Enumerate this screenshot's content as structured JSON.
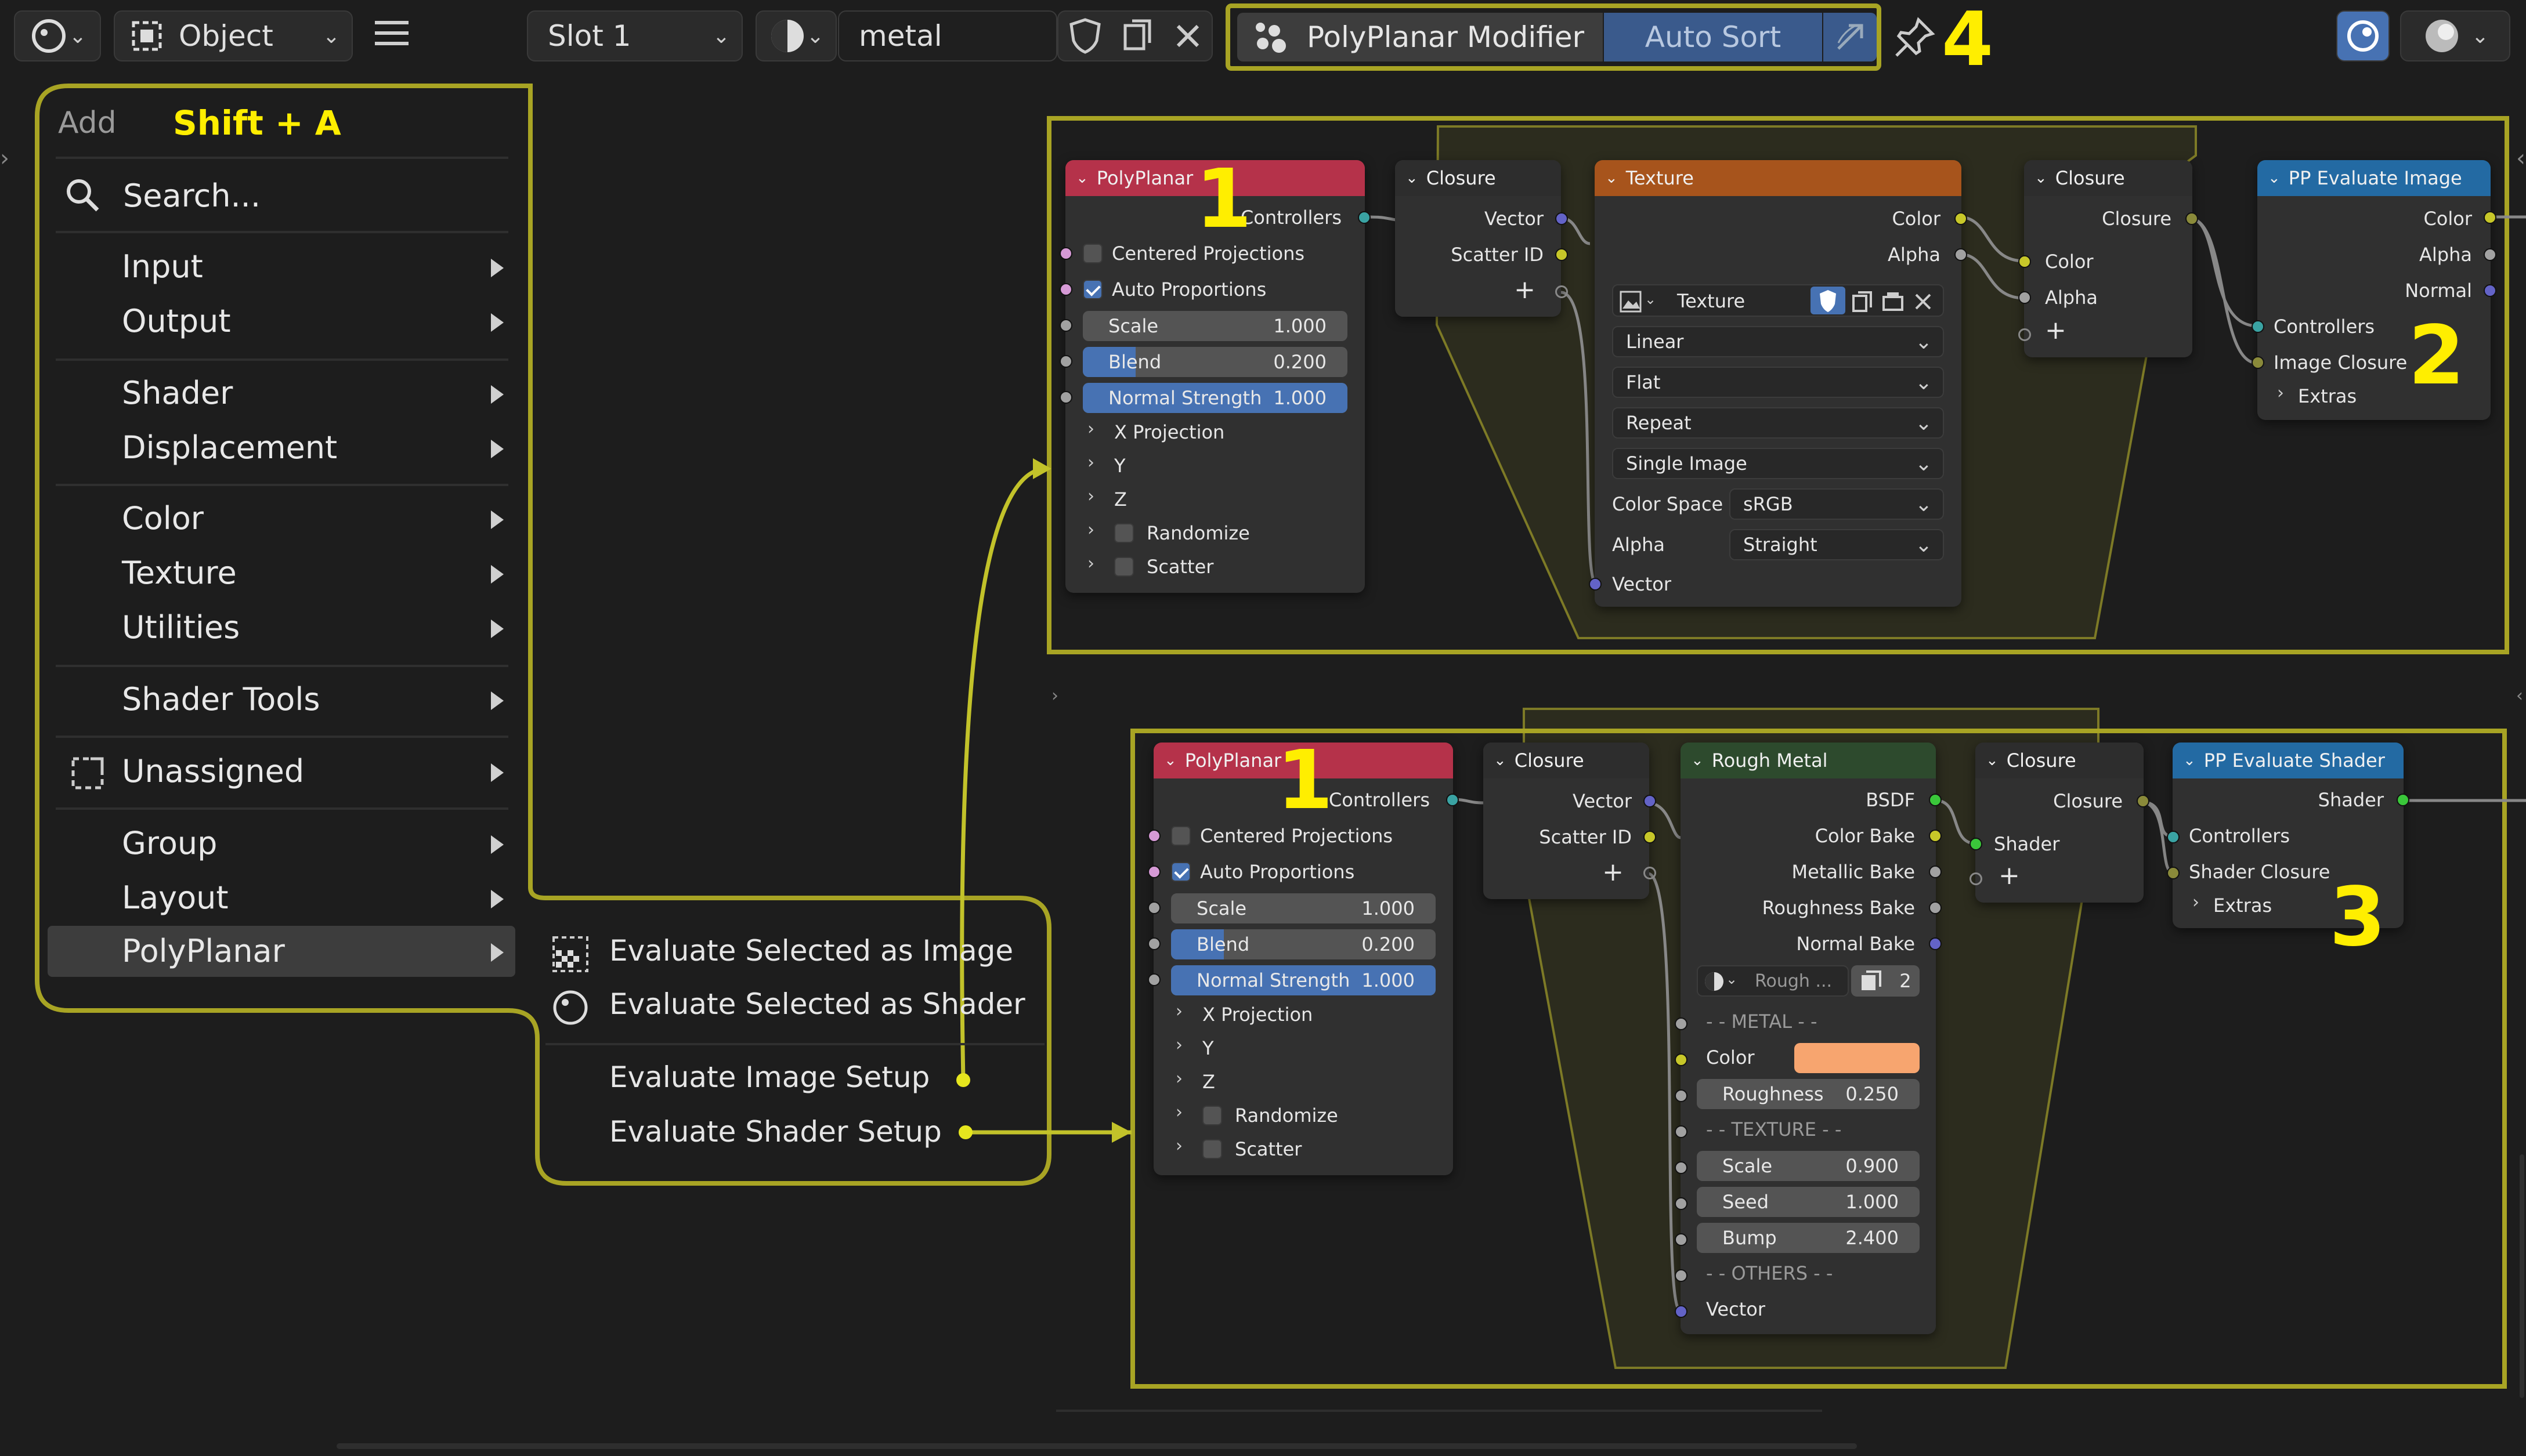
{
  "header": {
    "mode": "Object",
    "slot": "Slot 1",
    "material": "metal",
    "panel_title": "PolyPlanar Modifier",
    "auto_sort": "Auto Sort",
    "annotation": "4"
  },
  "add_menu": {
    "title": "Add",
    "shortcut": "Shift + A",
    "search_placeholder": "Search...",
    "items": [
      "Input",
      "Output",
      "Shader",
      "Displacement",
      "Color",
      "Texture",
      "Utilities",
      "Shader Tools",
      "Unassigned",
      "Group",
      "Layout",
      "PolyPlanar"
    ]
  },
  "submenu": {
    "items": [
      "Evaluate Selected as Image",
      "Evaluate Selected as Shader",
      "Evaluate Image Setup",
      "Evaluate Shader Setup"
    ]
  },
  "annotations": {
    "n1a": "1",
    "n1b": "1",
    "n2": "2",
    "n3": "3"
  },
  "top": {
    "polyplanar": {
      "title": "PolyPlanar",
      "controllers": "Controllers",
      "centered": "Centered Projections",
      "auto_prop": "Auto Proportions",
      "scale_label": "Scale",
      "scale": "1.000",
      "blend_label": "Blend",
      "blend": "0.200",
      "normal_label": "Normal Strength",
      "normal": "1.000",
      "xproj": "X Projection",
      "y": "Y",
      "z": "Z",
      "randomize": "Randomize",
      "scatter": "Scatter"
    },
    "closure1": {
      "title": "Closure",
      "vector": "Vector",
      "scatter_id": "Scatter ID"
    },
    "texture": {
      "title": "Texture",
      "color": "Color",
      "alpha": "Alpha",
      "tex_name": "Texture",
      "interp": "Linear",
      "proj": "Flat",
      "ext": "Repeat",
      "source": "Single Image",
      "cs_label": "Color Space",
      "cs": "sRGB",
      "alpha_label": "Alpha",
      "alpha_mode": "Straight",
      "vector": "Vector"
    },
    "closure2": {
      "title": "Closure",
      "closure": "Closure",
      "color": "Color",
      "alpha": "Alpha"
    },
    "pp_eval": {
      "title": "PP Evaluate Image",
      "color": "Color",
      "alpha": "Alpha",
      "normal": "Normal",
      "controllers": "Controllers",
      "image_closure": "Image Closure",
      "extras": "Extras"
    }
  },
  "bottom": {
    "polyplanar": {
      "title": "PolyPlanar",
      "controllers": "Controllers",
      "centered": "Centered Projections",
      "auto_prop": "Auto Proportions",
      "scale_label": "Scale",
      "scale": "1.000",
      "blend_label": "Blend",
      "blend": "0.200",
      "normal_label": "Normal Strength",
      "normal": "1.000",
      "xproj": "X Projection",
      "y": "Y",
      "z": "Z",
      "randomize": "Randomize",
      "scatter": "Scatter"
    },
    "closure1": {
      "title": "Closure",
      "vector": "Vector",
      "scatter_id": "Scatter ID"
    },
    "rough": {
      "title": "Rough Metal",
      "bsdf": "BSDF",
      "color_bake": "Color Bake",
      "metallic_bake": "Metallic Bake",
      "roughness_bake": "Roughness Bake",
      "normal_bake": "Normal Bake",
      "group_name": "Rough ...",
      "users": "2",
      "metal_sep": "- - METAL - -",
      "color": "Color",
      "color_value": "#f7a56f",
      "rough_label": "Roughness",
      "rough": "0.250",
      "tex_sep": "- - TEXTURE - -",
      "scale_label": "Scale",
      "scale": "0.900",
      "seed_label": "Seed",
      "seed": "1.000",
      "bump_label": "Bump",
      "bump": "2.400",
      "others_sep": "- - OTHERS - -",
      "vector": "Vector"
    },
    "closure2": {
      "title": "Closure",
      "closure": "Closure",
      "shader": "Shader"
    },
    "pp_eval": {
      "title": "PP Evaluate Shader",
      "shader": "Shader",
      "controllers": "Controllers",
      "shader_closure": "Shader Closure",
      "extras": "Extras"
    }
  },
  "colors": {
    "annotation": "#ffee00",
    "frame": "#a8a424",
    "polyplanar_head": "#b5324a",
    "closure_head": "#2d2d2d",
    "texture_head": "#a7541c",
    "pp_head": "#236aa3",
    "rough_head": "#2d4a2d"
  }
}
